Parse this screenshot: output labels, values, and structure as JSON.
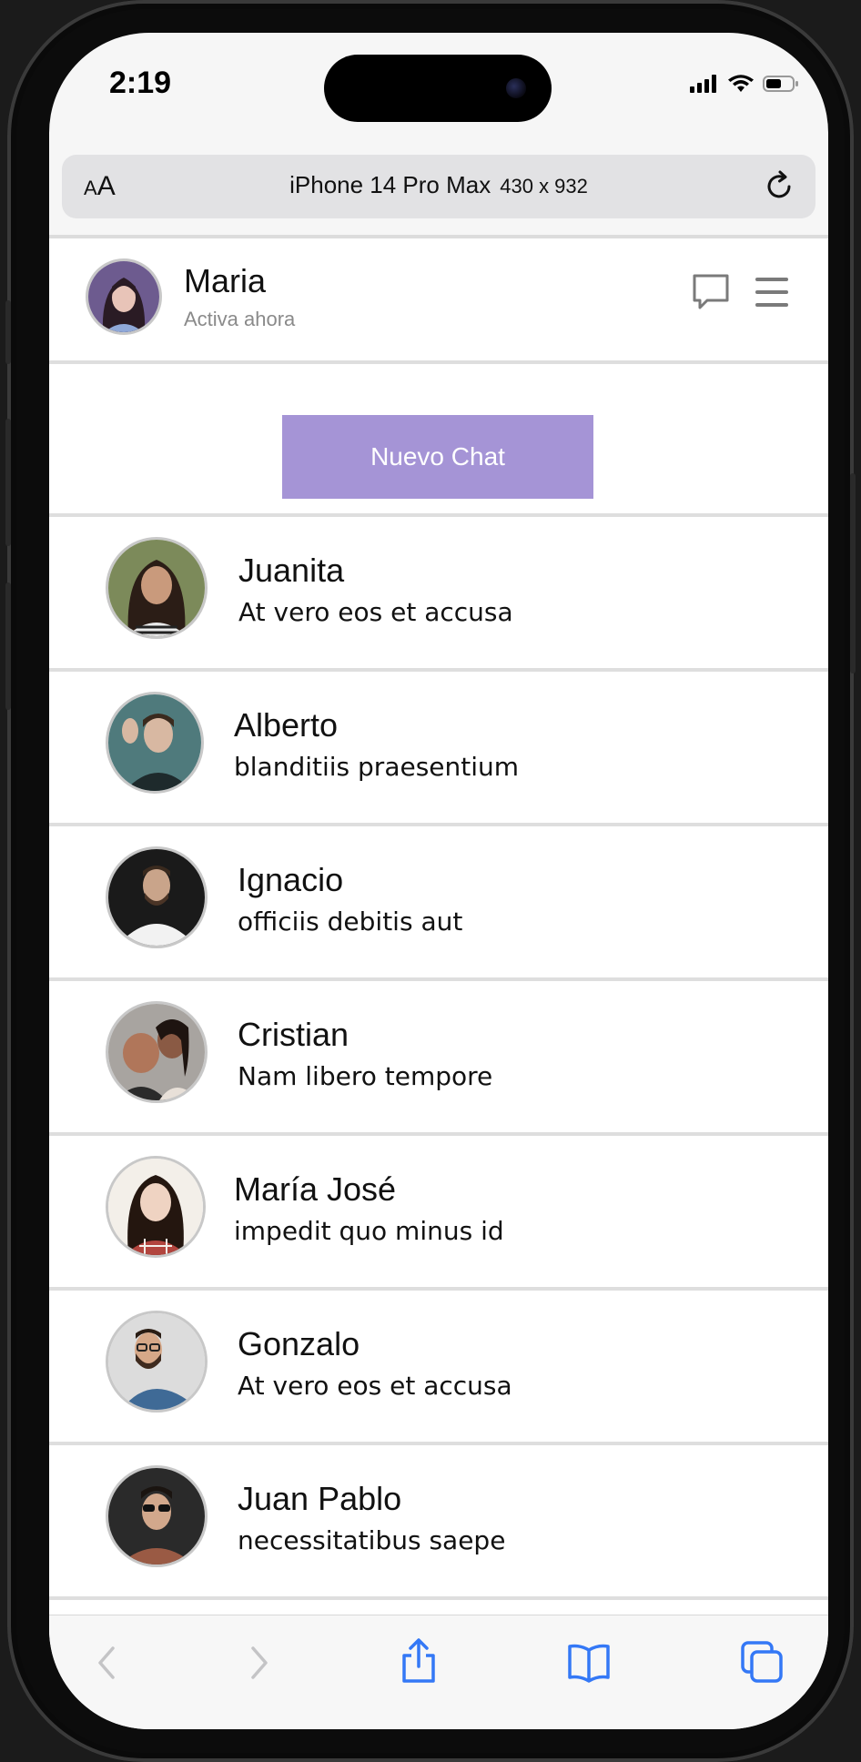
{
  "status_bar": {
    "time": "2:19"
  },
  "address_bar": {
    "text_size_small": "A",
    "text_size_large": "A",
    "device_name": "iPhone 14 Pro Max",
    "device_size": "430 x 932"
  },
  "header": {
    "user_name": "Maria",
    "user_status": "Activa ahora",
    "icons": [
      "chat-bubble-icon",
      "hamburger-menu-icon"
    ]
  },
  "new_chat": {
    "label": "Nuevo Chat"
  },
  "chats": [
    {
      "name": "Juanita",
      "message": "At vero eos et accusa"
    },
    {
      "name": "Alberto",
      "message": "blanditiis praesentium"
    },
    {
      "name": "Ignacio",
      "message": "officiis debitis aut"
    },
    {
      "name": "Cristian",
      "message": "Nam libero tempore"
    },
    {
      "name": "María José",
      "message": "impedit quo minus id"
    },
    {
      "name": "Gonzalo",
      "message": "At vero eos et accusa"
    },
    {
      "name": "Juan Pablo",
      "message": "necessitatibus saepe"
    }
  ],
  "toolbar": {
    "icons": [
      "back-icon",
      "forward-icon",
      "share-icon",
      "bookmarks-icon",
      "tabs-icon"
    ]
  },
  "colors": {
    "accent": "#a594d6",
    "ios_blue": "#3478f6",
    "divider": "#dedede"
  }
}
